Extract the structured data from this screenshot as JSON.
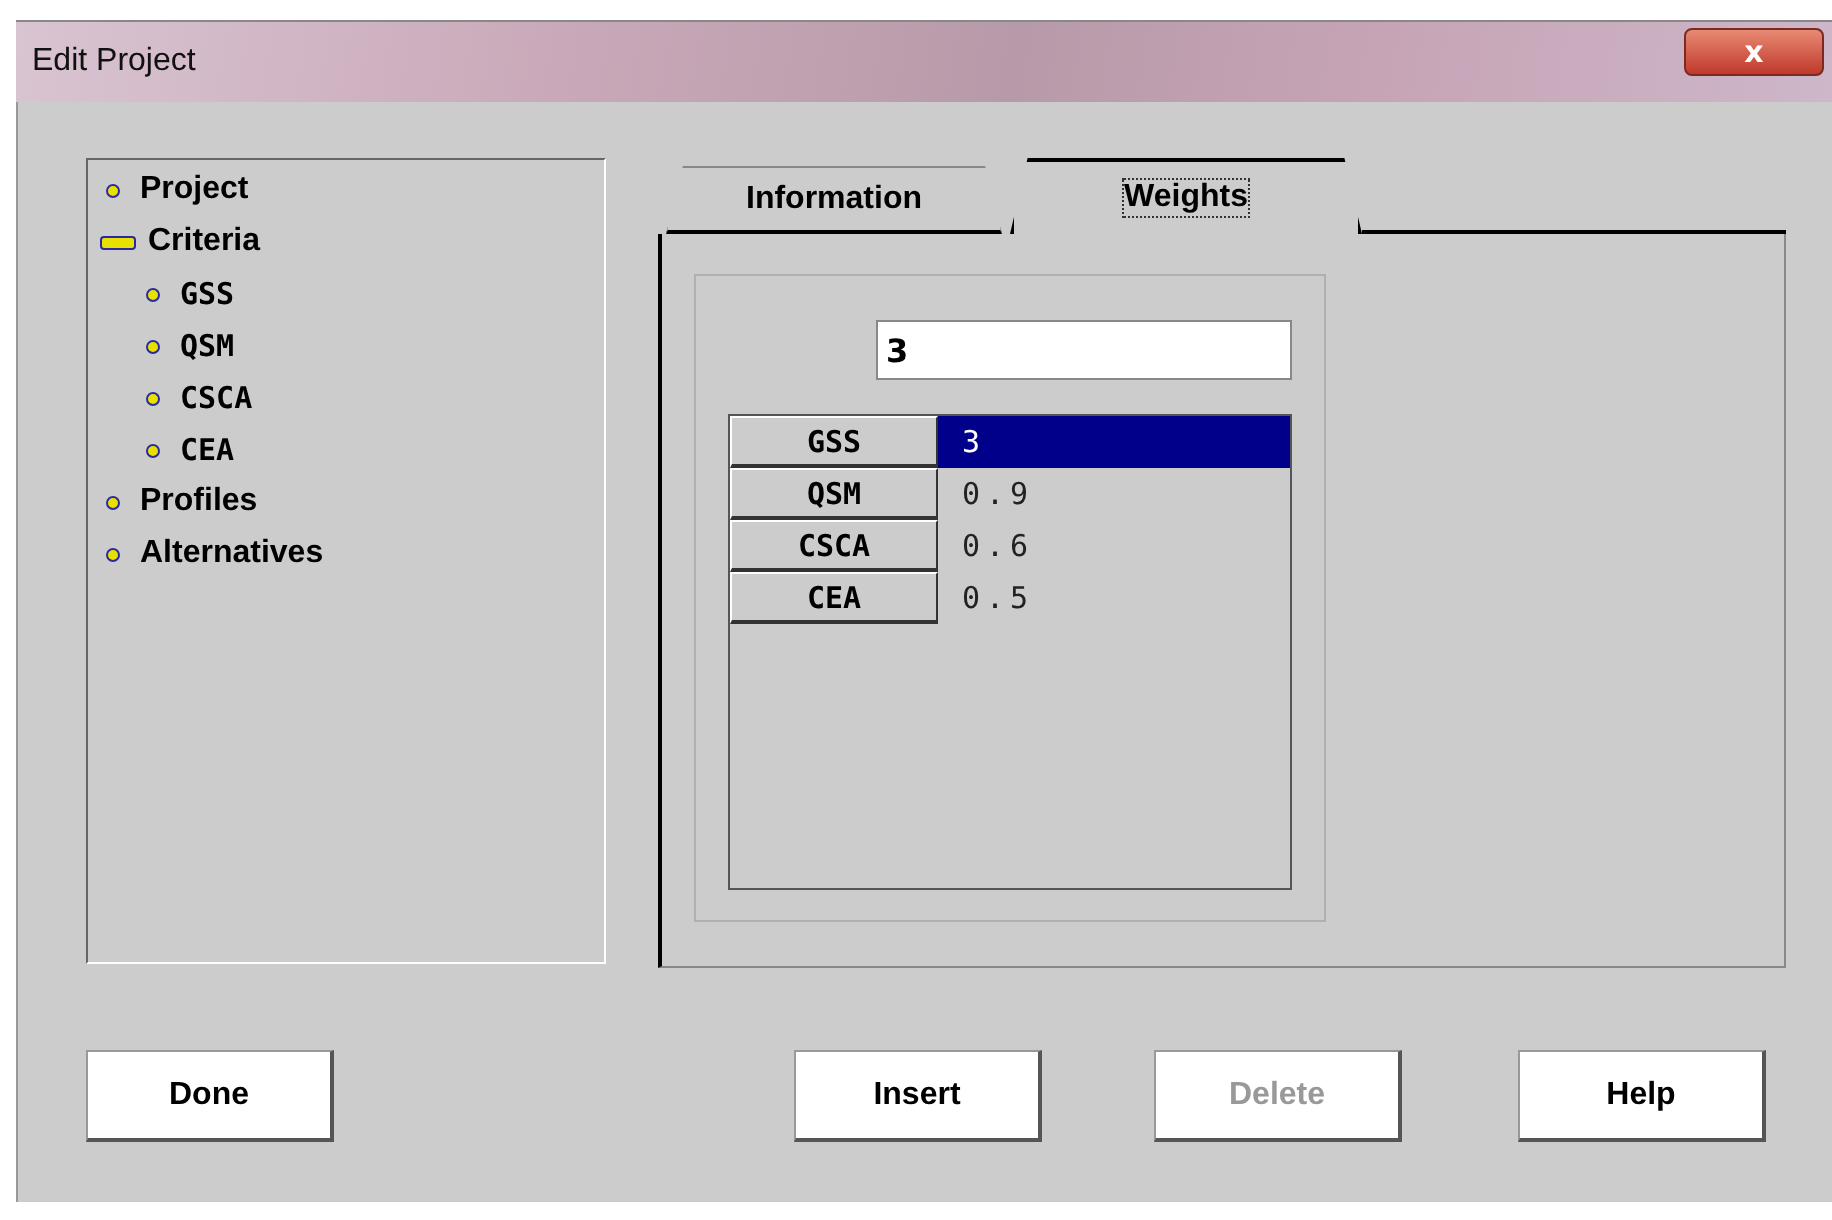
{
  "window": {
    "title": "Edit  Project",
    "close": "x"
  },
  "tree": [
    {
      "label": "Project"
    },
    {
      "label": "Criteria",
      "expanded": true,
      "children": [
        {
          "label": "GSS"
        },
        {
          "label": "QSM"
        },
        {
          "label": "CSCA"
        },
        {
          "label": "CEA"
        }
      ]
    },
    {
      "label": "Profiles"
    },
    {
      "label": "Alternatives"
    }
  ],
  "tabs": [
    {
      "label": "Information",
      "selected": false
    },
    {
      "label": "Weights",
      "selected": true
    }
  ],
  "weight_field": {
    "value": "3"
  },
  "grid": [
    {
      "header": "GSS",
      "value": "3",
      "selected": true
    },
    {
      "header": "QSM",
      "value": "0.9",
      "selected": false
    },
    {
      "header": "CSCA",
      "value": "0.6",
      "selected": false
    },
    {
      "header": "CEA",
      "value": "0.5",
      "selected": false
    }
  ],
  "buttons": [
    {
      "label": "Done",
      "disabled": false
    },
    {
      "label": "Insert",
      "disabled": false
    },
    {
      "label": "Delete",
      "disabled": true
    },
    {
      "label": "Help",
      "disabled": false
    }
  ]
}
